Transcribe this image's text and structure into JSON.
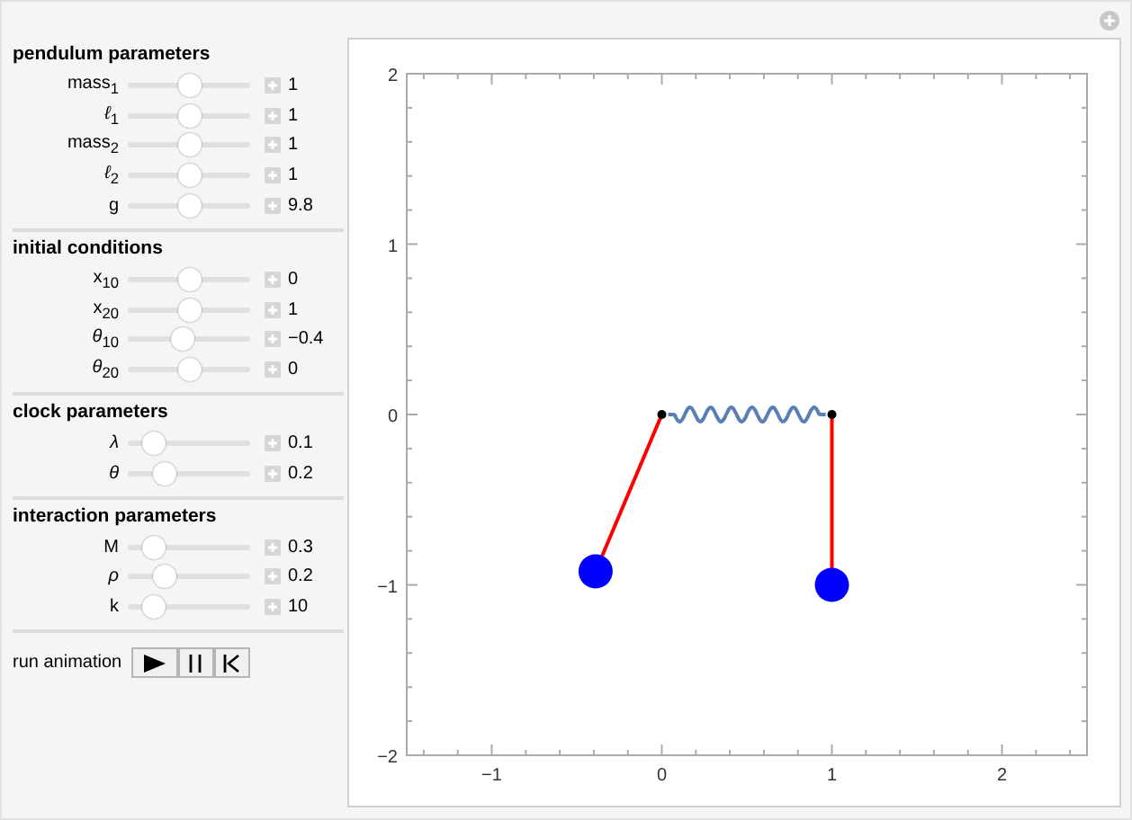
{
  "sections": [
    {
      "title": "pendulum parameters",
      "controls": [
        {
          "label": "mass$_{1}$",
          "level": 0.5,
          "value": "1"
        },
        {
          "label": "*ℓ*$_{1}$",
          "level": 0.5,
          "value": "1"
        },
        {
          "label": "mass$_{2}$",
          "level": 0.5,
          "value": "1"
        },
        {
          "label": "*ℓ*$_{2}$",
          "level": 0.5,
          "value": "1"
        },
        {
          "label": "g",
          "level": 0.5,
          "value": "9.8"
        }
      ]
    },
    {
      "title": "initial conditions",
      "controls": [
        {
          "label": "x$_{10}$",
          "level": 0.5,
          "value": "0"
        },
        {
          "label": "x$_{20}$",
          "level": 0.5,
          "value": "1"
        },
        {
          "label": "*θ*$_{10}$",
          "level": 0.43,
          "value": "−0.4"
        },
        {
          "label": "*θ*$_{20}$",
          "level": 0.5,
          "value": "0"
        }
      ]
    },
    {
      "title": "clock parameters",
      "controls": [
        {
          "label": "*λ*",
          "level": 0.15,
          "value": "0.1"
        },
        {
          "label": "*θ*",
          "level": 0.25,
          "value": "0.2"
        }
      ]
    },
    {
      "title": "interaction parameters",
      "controls": [
        {
          "label": "M",
          "level": 0.15,
          "value": "0.3"
        },
        {
          "label": "*ρ*",
          "level": 0.25,
          "value": "0.2"
        },
        {
          "label": "k",
          "level": 0.15,
          "value": "10"
        }
      ]
    }
  ],
  "animation": {
    "label": "run animation",
    "buttons": [
      {
        "kind": "play"
      },
      {
        "kind": "pause"
      },
      {
        "kind": "reset"
      }
    ]
  },
  "plot": {
    "xtick_labels": [
      "−1",
      "0",
      "1",
      "2"
    ],
    "ytick_labels": [
      "2",
      "1",
      "0",
      "−1",
      "−2"
    ]
  }
}
